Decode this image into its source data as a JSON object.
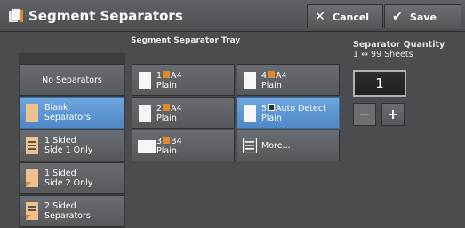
{
  "header": {
    "title": "Segment Separators",
    "cancel_label": "Cancel",
    "save_label": "Save"
  },
  "separators": [
    {
      "label1": "No Separators",
      "label2": "",
      "selected": false
    },
    {
      "label1": "Blank",
      "label2": "Separators",
      "selected": true
    },
    {
      "label1": "1 Sided",
      "label2": "Side 1 Only",
      "selected": false
    },
    {
      "label1": "1 Sided",
      "label2": "Side 2 Only",
      "selected": false
    },
    {
      "label1": "2 Sided",
      "label2": "Separators",
      "selected": false
    }
  ],
  "tray": {
    "heading": "Segment Separator Tray",
    "items": [
      {
        "num": "1",
        "size": "A4",
        "type": "Plain",
        "selected": false
      },
      {
        "num": "4",
        "size": "A4",
        "type": "Plain",
        "selected": false
      },
      {
        "num": "2",
        "size": "A4",
        "type": "Plain",
        "selected": false
      },
      {
        "num": "5",
        "size": "Auto Detect",
        "type": "Plain",
        "selected": true
      },
      {
        "num": "3",
        "size": "B4",
        "type": "Plain",
        "selected": false
      }
    ],
    "more_label": "More..."
  },
  "quantity": {
    "heading": "Separator Quantity",
    "range": "1 ↔ 99 Sheets",
    "value": "1",
    "minus": "−",
    "plus": "+"
  },
  "colors": {
    "background": "#4a4c50",
    "selected": "#5b95d4",
    "paper_accent": "#e08a2a"
  },
  "icons": [
    "separator-icon",
    "close-icon",
    "check-icon",
    "paper-icon",
    "list-icon"
  ]
}
